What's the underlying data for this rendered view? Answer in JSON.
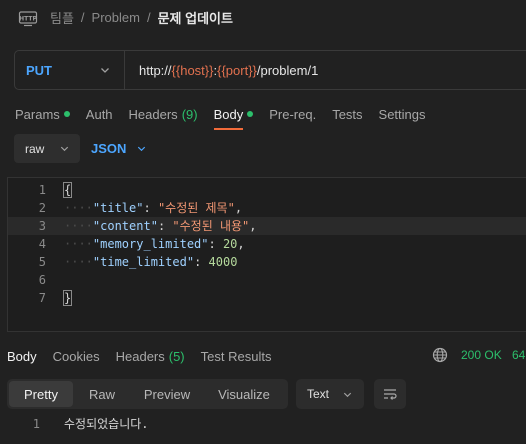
{
  "breadcrumb": {
    "team": "팀플",
    "collection": "Problem",
    "request": "문제 업데이트",
    "separator": "/"
  },
  "request": {
    "method": "PUT",
    "url_parts": [
      {
        "text": "http://",
        "var": false
      },
      {
        "text": "{{host}}",
        "var": true
      },
      {
        "text": ":",
        "var": false
      },
      {
        "text": "{{port}}",
        "var": true
      },
      {
        "text": "/problem/1",
        "var": false
      }
    ]
  },
  "request_tabs": {
    "params": "Params",
    "auth": "Auth",
    "headers": "Headers",
    "headers_count": "(9)",
    "body": "Body",
    "prereq": "Pre-req.",
    "tests": "Tests",
    "settings": "Settings"
  },
  "body_mode": {
    "raw": "raw",
    "format": "JSON"
  },
  "editor": {
    "line_numbers": [
      "1",
      "2",
      "3",
      "4",
      "5",
      "6",
      "7"
    ],
    "open_brace": "{",
    "close_brace": "}",
    "fields": [
      {
        "key": "\"title\"",
        "sep": ": ",
        "value": "\"수정된 제목\"",
        "type": "str",
        "trail": ","
      },
      {
        "key": "\"content\"",
        "sep": ": ",
        "value": "\"수정된 내용\"",
        "type": "str",
        "trail": ","
      },
      {
        "key": "\"memory_limited\"",
        "sep": ": ",
        "value": "20",
        "type": "num",
        "trail": ","
      },
      {
        "key": "\"time_limited\"",
        "sep": ": ",
        "value": "4000",
        "type": "num",
        "trail": ""
      }
    ],
    "indent": "····"
  },
  "response_tabs": {
    "body": "Body",
    "cookies": "Cookies",
    "headers": "Headers",
    "headers_count": "(5)",
    "test_results": "Test Results"
  },
  "response_status": {
    "code": "200 OK",
    "time": "64"
  },
  "response_view": {
    "pretty": "Pretty",
    "raw": "Raw",
    "preview": "Preview",
    "visualize": "Visualize",
    "text_format": "Text"
  },
  "response_body": {
    "line_number": "1",
    "text": "수정되었습니다."
  },
  "colors": {
    "accent": "#f26b3a",
    "method": "#4ca6ff",
    "success": "#2cbf6b",
    "variable": "#e2714f"
  }
}
